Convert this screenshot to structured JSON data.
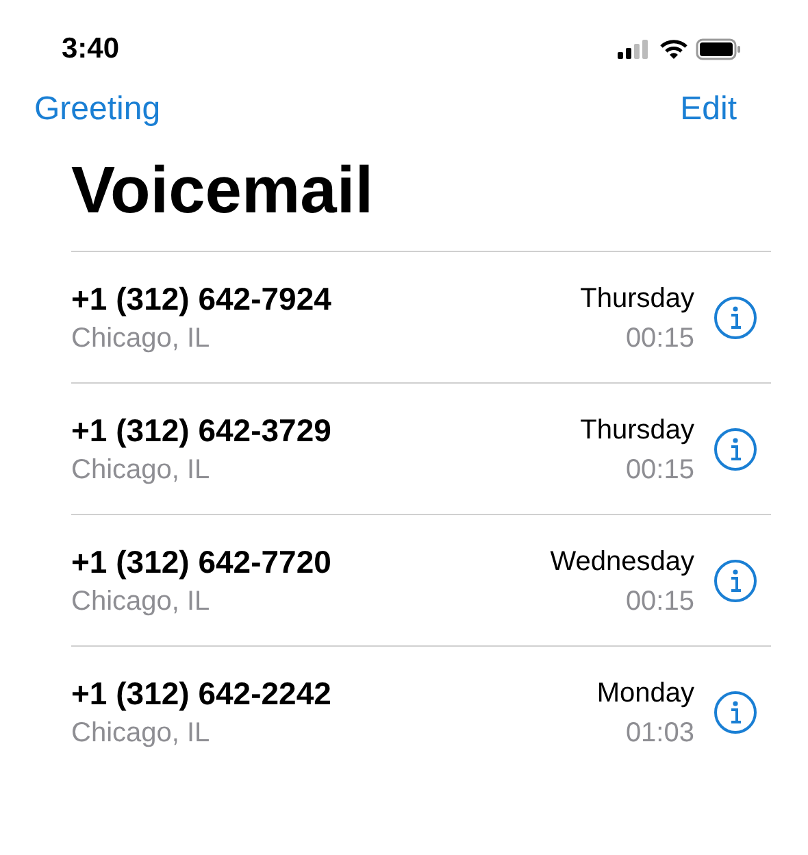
{
  "status_bar": {
    "time": "3:40"
  },
  "nav": {
    "left": "Greeting",
    "right": "Edit"
  },
  "title": "Voicemail",
  "messages": [
    {
      "number": "+1 (312) 642-7924",
      "location": "Chicago, IL",
      "day": "Thursday",
      "duration": "00:15"
    },
    {
      "number": "+1 (312) 642-3729",
      "location": "Chicago, IL",
      "day": "Thursday",
      "duration": "00:15"
    },
    {
      "number": "+1 (312) 642-7720",
      "location": "Chicago, IL",
      "day": "Wednesday",
      "duration": "00:15"
    },
    {
      "number": "+1 (312) 642-2242",
      "location": "Chicago, IL",
      "day": "Monday",
      "duration": "01:03"
    }
  ]
}
